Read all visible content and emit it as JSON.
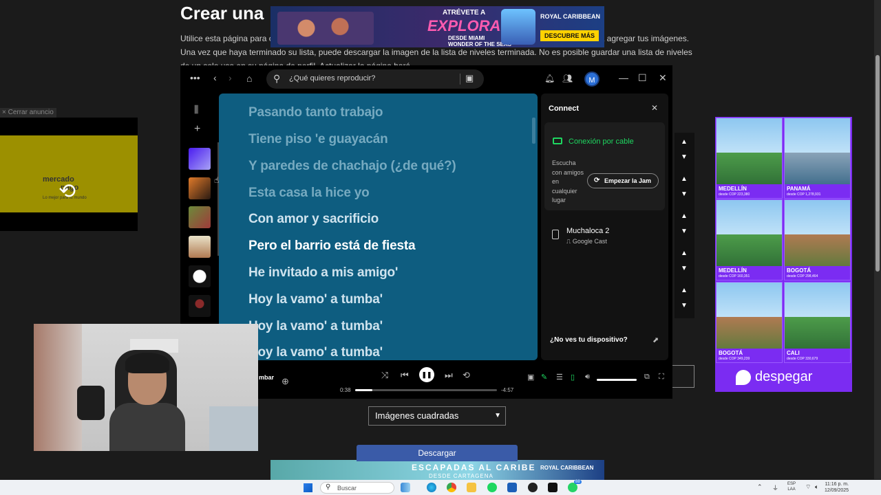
{
  "page": {
    "title": "Crear una",
    "paragraph": "Utilice esta página para cr                                                                                                                       a para otros usuarios del sitio web. Usa el botón Cargar debajo de la lista de niveles para agregar tus imágenes. Una vez que haya terminado su lista, puede descargar la imagen de la lista de niveles terminada. No es posible guardar una lista de niveles de un solo uso en su página de perfil. Actualizar la página hará",
    "close_ad": "× Cerrar anuncio",
    "select_value": "Imágenes cuadradas",
    "download_label": "Descargar"
  },
  "ads": {
    "left": {
      "brand": "mercado",
      "brand2": "pago",
      "tagline": "Lo mejor para tu mundo"
    },
    "top": {
      "line1": "ATRÉVETE A",
      "line2": "EXPLORAR",
      "line3": "DESDE MIAMI",
      "line4": "WONDER OF THE SEAS",
      "brand": "ROYAL CARIBBEAN",
      "cta": "DESCUBRE MÁS"
    },
    "bottom": {
      "title": "ESCAPADAS AL CARIBE",
      "subtitle": "DESDE CARTAGENA",
      "brand": "ROYAL CARIBBEAN"
    },
    "right": {
      "tiles": [
        {
          "city": "MEDELLÍN",
          "price": "desde COP 223,380"
        },
        {
          "city": "PANAMÁ",
          "price": "desde COP 1,278,931"
        },
        {
          "city": "MEDELLÍN",
          "price": "desde COP 160,351"
        },
        {
          "city": "BOGOTÁ",
          "price": "desde COP 298,464"
        },
        {
          "city": "BOGOTÁ",
          "price": "desde COP 349,239"
        },
        {
          "city": "CALI",
          "price": "desde COP 330,679"
        }
      ],
      "brand": "despegar"
    }
  },
  "spotify": {
    "search_placeholder": "¿Qué quieres reproducir?",
    "avatar_letter": "M",
    "lyrics": [
      {
        "text": "Pasando tanto trabajo",
        "state": "past"
      },
      {
        "text": "Tiene piso 'e guayacán",
        "state": "past"
      },
      {
        "text": "Y paredes de chachajo (¿de qué?)",
        "state": "past"
      },
      {
        "text": "Esta casa la hice yo",
        "state": "past"
      },
      {
        "text": "Con amor y sacrificio",
        "state": "past"
      },
      {
        "text": "Pero el barrio está de fiesta",
        "state": "now"
      },
      {
        "text": "He invitado a mis amigo'",
        "state": "next"
      },
      {
        "text": "Hoy la vamo' a tumba'",
        "state": "next"
      },
      {
        "text": "Hoy la vamo' a tumba'",
        "state": "next"
      },
      {
        "text": "Hoy la vamo' a tumba'",
        "state": "next"
      }
    ],
    "connect": {
      "title": "Connect",
      "cable_label": "Conexión por cable",
      "friends_text": "Escucha con amigos en cualquier lugar",
      "jam_button": "Empezar la Jam",
      "device_name": "Muchaloca 2",
      "device_type": "Google Cast",
      "no_device": "¿No ves tu dispositivo?"
    },
    "player": {
      "partial_label": "mbar",
      "elapsed": "0:38",
      "remaining": "-4:57",
      "progress_fraction": 0.12,
      "volume_fraction": 1.0
    }
  },
  "taskbar": {
    "search_placeholder": "Buscar",
    "lang_line1": "ESP",
    "lang_line2": "LAA",
    "time": "11:16 p. m.",
    "date": "12/09/2025",
    "badge": "88"
  },
  "colors": {
    "lyrics_bg": "#0e5d80",
    "spotify_green": "#1ed760",
    "despegar_purple": "#7b2cf2"
  }
}
